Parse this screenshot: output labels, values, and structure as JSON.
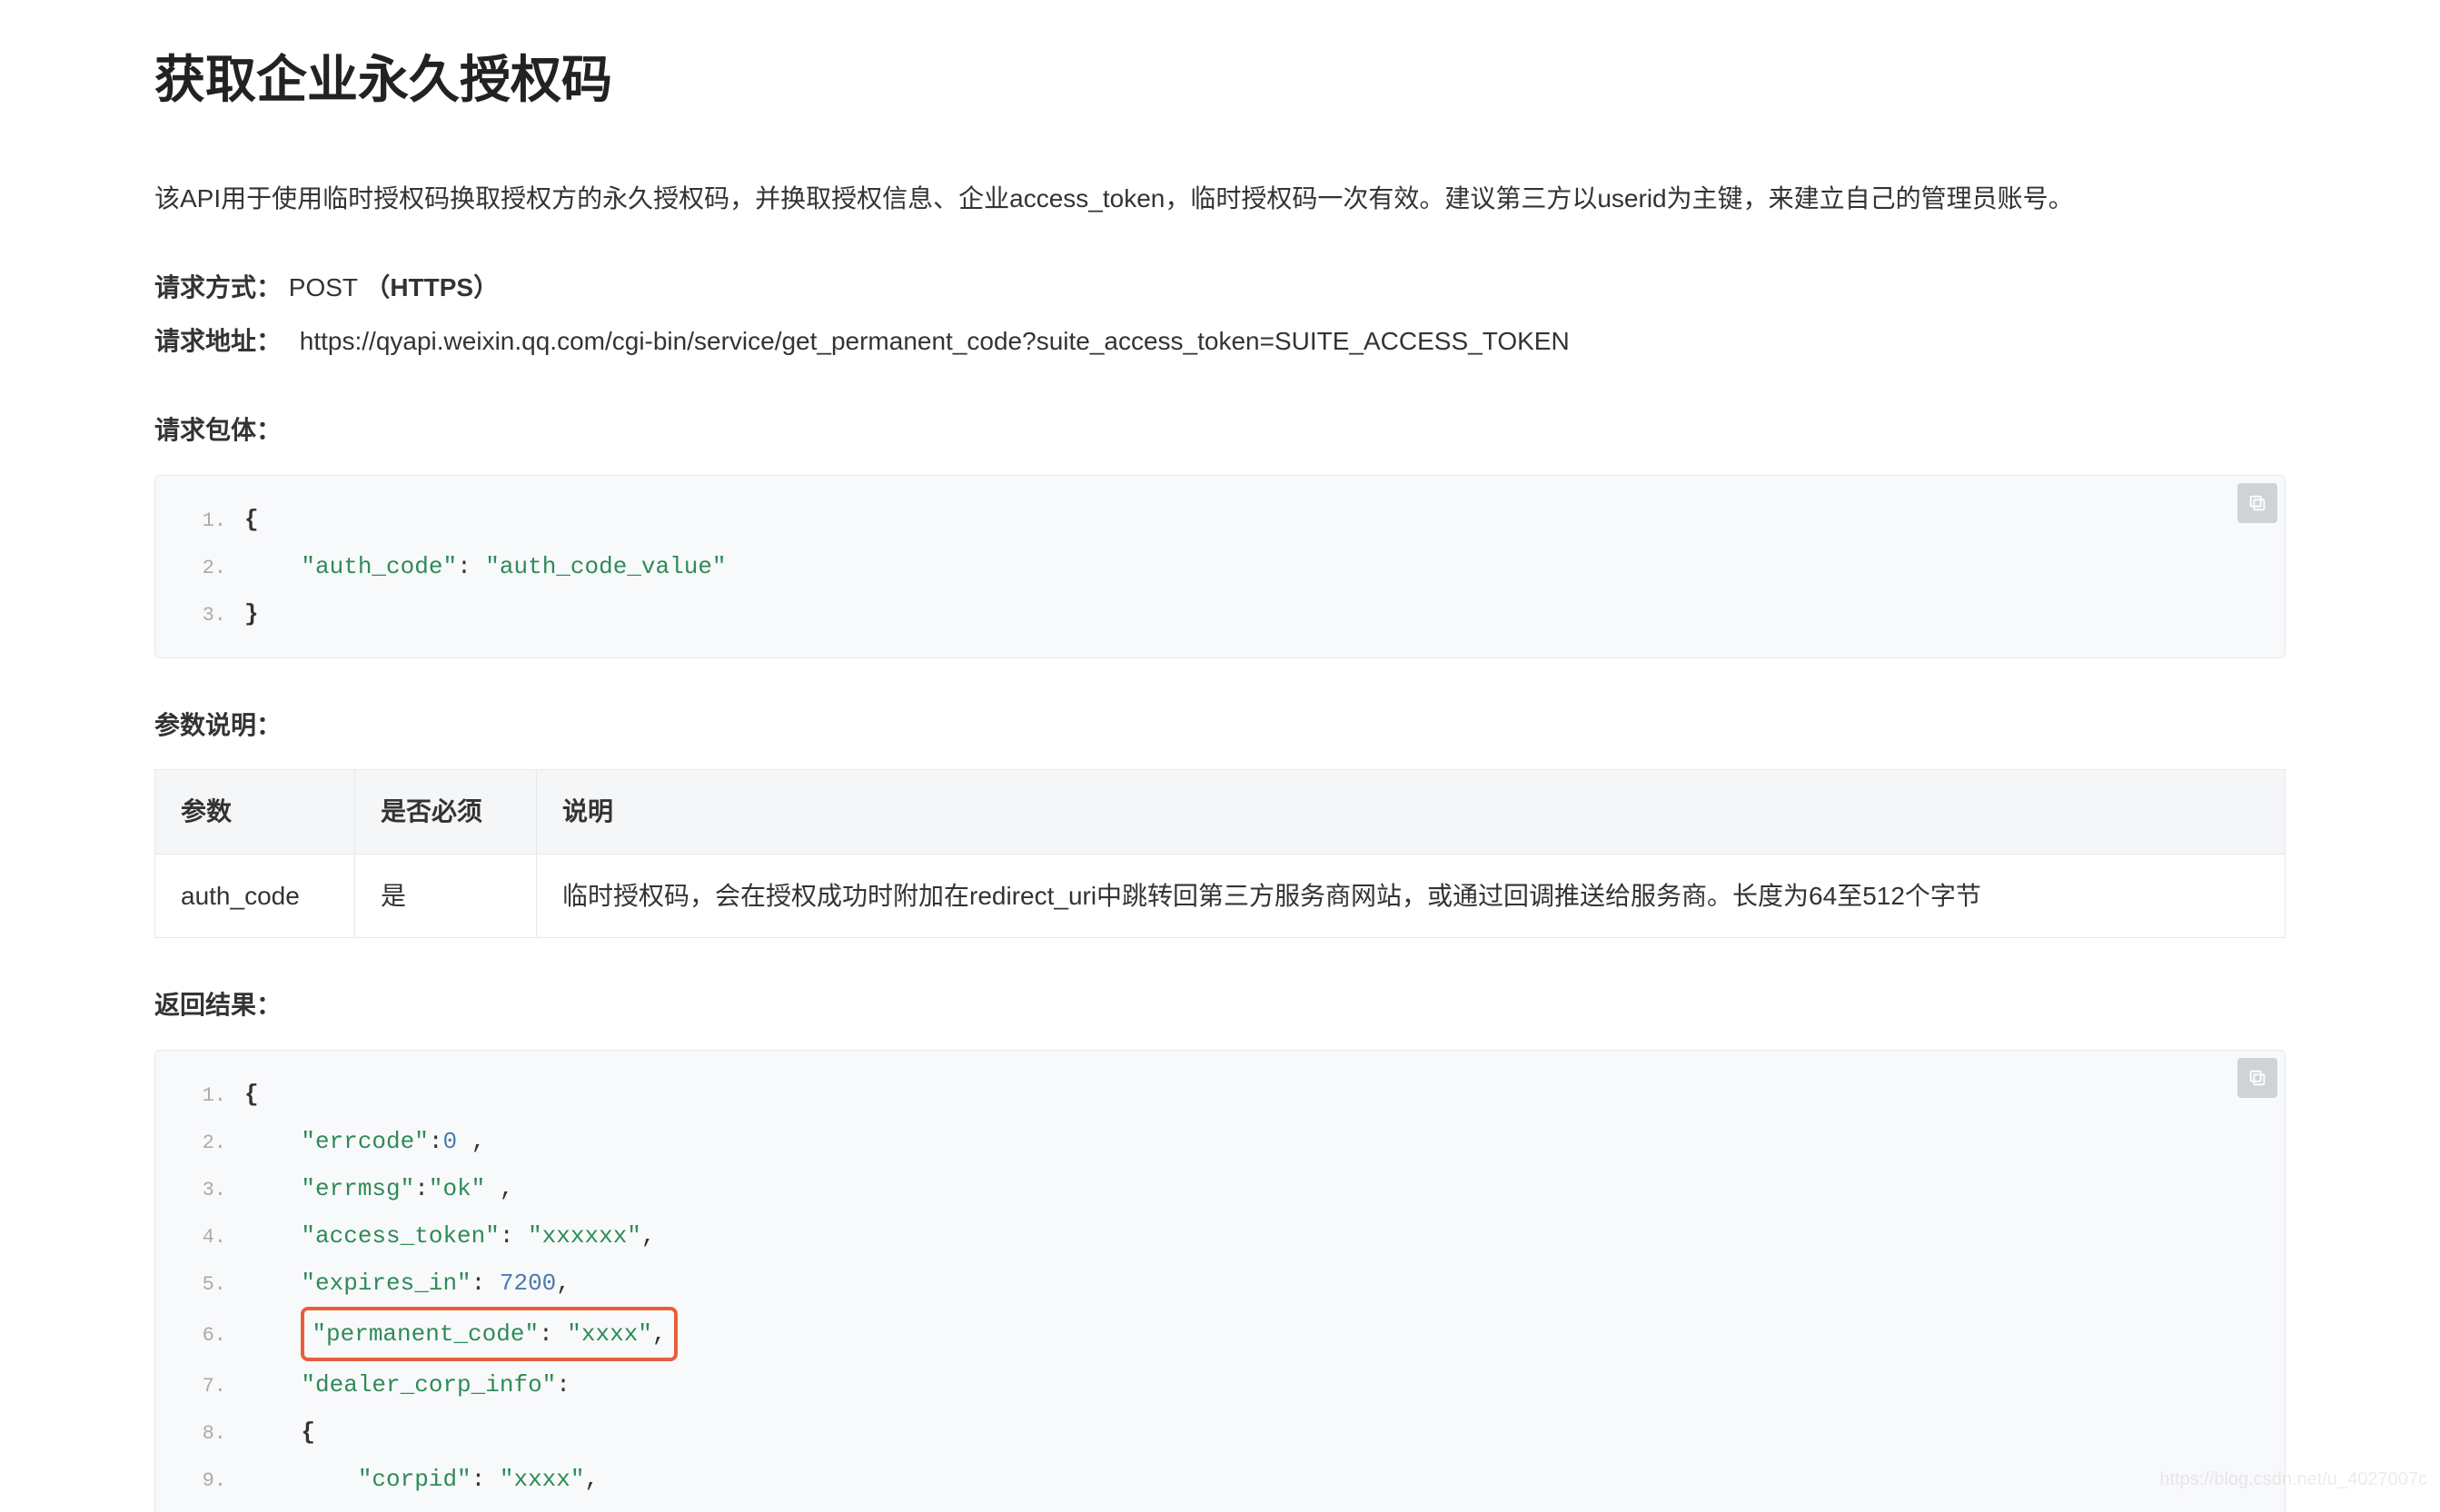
{
  "title": "获取企业永久授权码",
  "description": "该API用于使用临时授权码换取授权方的永久授权码，并换取授权信息、企业access_token，临时授权码一次有效。建议第三方以userid为主键，来建立自己的管理员账号。",
  "request": {
    "method_label": "请求方式：",
    "method_value": "POST",
    "protocol": "（HTTPS）",
    "url_label": "请求地址：",
    "url_value": "https://qyapi.weixin.qq.com/cgi-bin/service/get_permanent_code?suite_access_token=SUITE_ACCESS_TOKEN"
  },
  "sections": {
    "body_title": "请求包体：",
    "params_title": "参数说明：",
    "result_title": "返回结果："
  },
  "code1": {
    "lines": [
      {
        "n": "1.",
        "text": "{"
      },
      {
        "n": "2.",
        "text": "    \"auth_code\": \"auth_code_value\""
      },
      {
        "n": "3.",
        "text": "}"
      }
    ]
  },
  "params_table": {
    "headers": [
      "参数",
      "是否必须",
      "说明"
    ],
    "rows": [
      [
        "auth_code",
        "是",
        "临时授权码，会在授权成功时附加在redirect_uri中跳转回第三方服务商网站，或通过回调推送给服务商。长度为64至512个字节"
      ]
    ]
  },
  "code2": {
    "lines": [
      {
        "n": "1.",
        "text": "{"
      },
      {
        "n": "2.",
        "text": "    \"errcode\":0 ,"
      },
      {
        "n": "3.",
        "text": "    \"errmsg\":\"ok\" ,"
      },
      {
        "n": "4.",
        "text": "    \"access_token\": \"xxxxxx\","
      },
      {
        "n": "5.",
        "text": "    \"expires_in\": 7200,"
      },
      {
        "n": "6.",
        "text": "    \"permanent_code\": \"xxxx\",",
        "highlight": true
      },
      {
        "n": "7.",
        "text": "    \"dealer_corp_info\":"
      },
      {
        "n": "8.",
        "text": "    {"
      },
      {
        "n": "9.",
        "text": "        \"corpid\": \"xxxx\","
      }
    ]
  },
  "watermark": "https://blog.csdn.net/u_4027007c"
}
